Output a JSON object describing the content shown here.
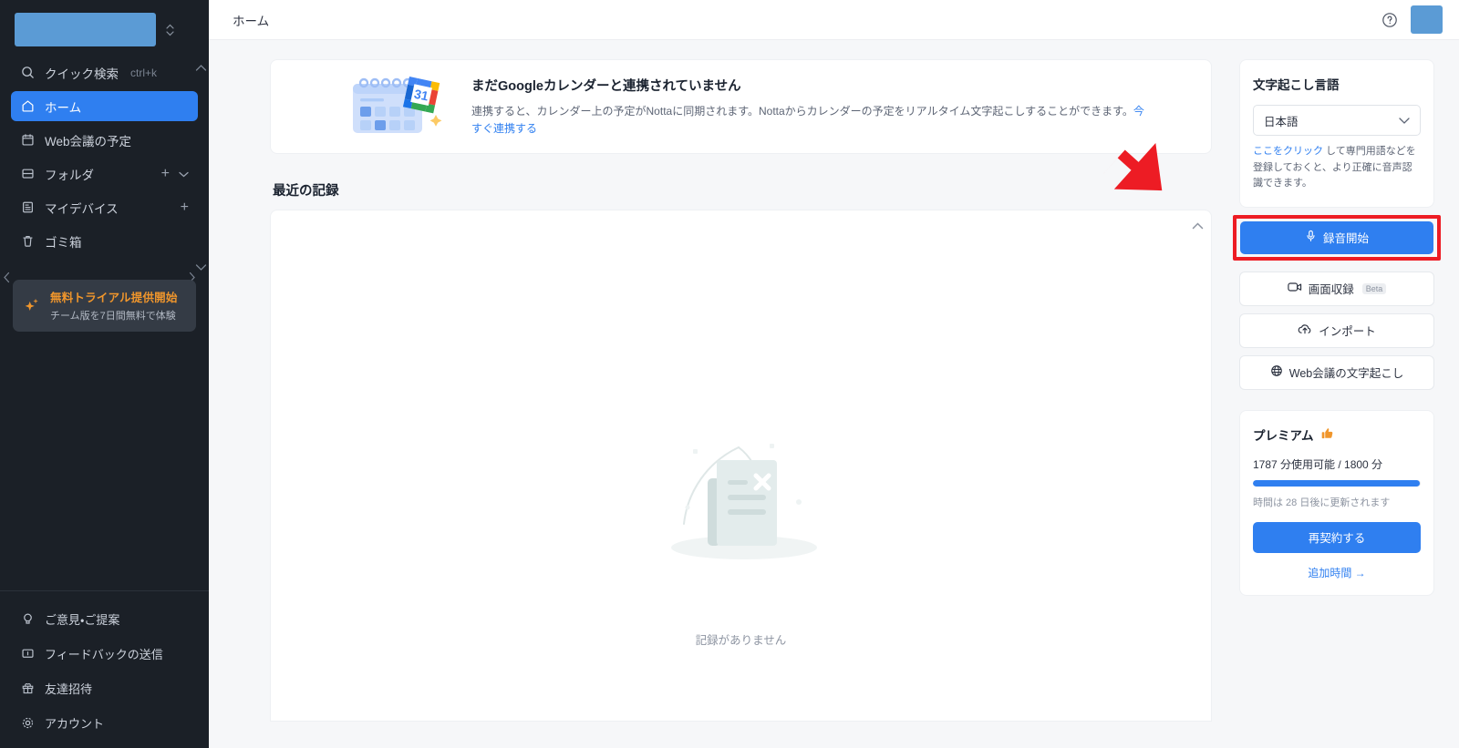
{
  "sidebar": {
    "workspace": {
      "name": "",
      "redacted": true
    },
    "quick_search": {
      "label": "クイック検索",
      "shortcut": "ctrl+k",
      "icon": "search-icon"
    },
    "items": [
      {
        "label": "ホーム",
        "icon": "home-icon",
        "active": true
      },
      {
        "label": "Web会議の予定",
        "icon": "calendar-icon",
        "active": false
      },
      {
        "label": "フォルダ",
        "icon": "folder-icon",
        "active": false,
        "trail_plus": "+",
        "trail_chevron": "chevron-down-icon"
      },
      {
        "label": "マイデバイス",
        "icon": "device-icon",
        "active": false,
        "trail_plus": "+"
      },
      {
        "label": "ゴミ箱",
        "icon": "trash-icon",
        "active": false
      }
    ],
    "trial": {
      "title": "無料トライアル提供開始",
      "subtitle": "チーム版を7日間無料で体験",
      "icon": "sparkles-icon",
      "accent": "#f0962c"
    },
    "bottom_items": [
      {
        "label": "ご意見・ご提案",
        "icon": "lightbulb-icon"
      },
      {
        "label": "フィードバックの送信",
        "icon": "message-icon"
      },
      {
        "label": "友達招待",
        "icon": "gift-icon"
      },
      {
        "label": "アカウント",
        "icon": "gear-icon"
      }
    ]
  },
  "topbar": {
    "breadcrumb": "ホーム",
    "help_icon": "help-circle-icon",
    "avatar": {
      "redacted": true
    }
  },
  "banner": {
    "illustration": "google-calendar-illustration",
    "title": "まだGoogleカレンダーと連携されていません",
    "description": "連携すると、カレンダー上の予定がNottaに同期されます。Nottaからカレンダーの予定をリアルタイム文字起こしすることができます。",
    "link": "今すぐ連携する"
  },
  "records": {
    "section_title": "最近の記録",
    "empty_text": "記録がありません",
    "empty_illustration": "empty-document-icon",
    "scroll_up_icon": "chevron-up-icon"
  },
  "right_panel": {
    "language": {
      "heading": "文字起こし言語",
      "selected": "日本語",
      "chevron": "chevron-down-icon",
      "hint_link": "ここをクリック",
      "hint_text": " して専門用語などを登録しておくと、より正確に音声認識できます。"
    },
    "actions": [
      {
        "label": "録音開始",
        "icon": "microphone-icon",
        "style": "primary",
        "highlighted": true
      },
      {
        "label": "画面収録",
        "icon": "video-camera-icon",
        "style": "ghost",
        "badge": "Beta"
      },
      {
        "label": "インポート",
        "icon": "upload-cloud-icon",
        "style": "ghost"
      },
      {
        "label": "Web会議の文字起こし",
        "icon": "globe-icon",
        "style": "ghost"
      }
    ],
    "premium": {
      "heading": "プレミアム",
      "heading_icon": "thumbs-up-icon",
      "usage_text": "1787 分使用可能 / 1800 分",
      "used_minutes": 1787,
      "total_minutes": 1800,
      "progress_percent": 99.3,
      "renew_text": "時間は 28 日後に更新されます",
      "cta_label": "再契約する",
      "link_label": "追加時間 →"
    }
  },
  "annotation": {
    "arrow": "red-arrow-pointing-to-record-button",
    "highlight_color": "#ed1c24"
  },
  "colors": {
    "accent_blue": "#2f7ff0",
    "sidebar_bg": "#1b2027",
    "page_bg": "#f6f7f9",
    "trial_orange": "#f0962c",
    "annotation_red": "#ed1c24"
  }
}
